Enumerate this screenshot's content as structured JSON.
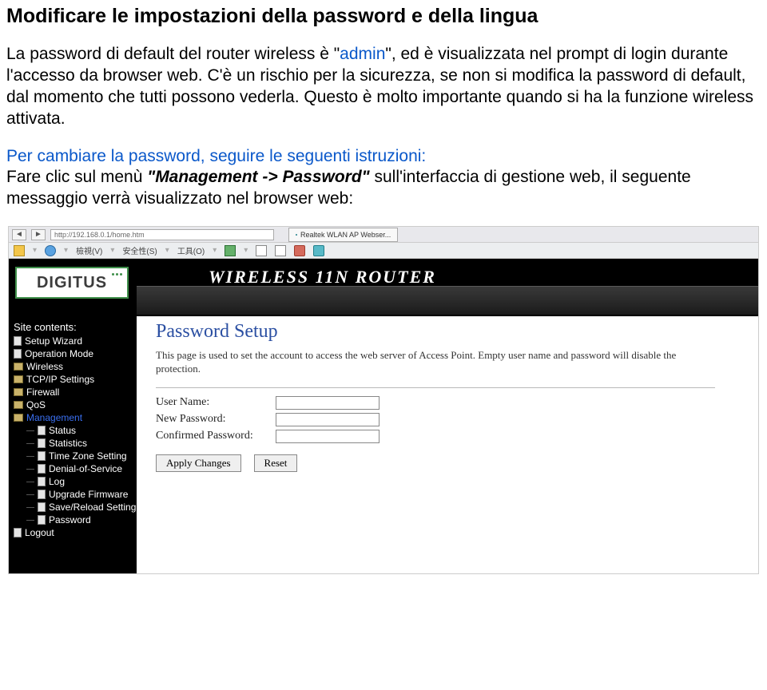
{
  "doc": {
    "title": "Modificare le impostazioni della password e della lingua",
    "para1_before": "La password di default del router wireless è \"",
    "para1_admin": "admin",
    "para1_after": "\", ed è visualizzata nel prompt di login durante l'accesso da browser web. C'è un rischio per la sicurezza, se non si modifica la password di default, dal momento che tutti possono vederla. Questo è molto importante quando si ha la funzione wireless attivata.",
    "para2_intro": "Per cambiare la password, seguire le seguenti istruzioni:",
    "para2_before": "Fare clic sul menù ",
    "para2_bold": "\"Management -> Password\"",
    "para2_after": " sull'interfaccia di gestione web, il seguente messaggio verrà visualizzato nel browser web:"
  },
  "browser": {
    "address": "http://192.168.0.1/home.htm",
    "tab": "Realtek WLAN AP Webser...",
    "menu_items": [
      "檢視(V)",
      "安全性(S)",
      "工具(O)"
    ]
  },
  "router": {
    "logo": "DIGITUS",
    "title": "WIRELESS 11N ROUTER"
  },
  "sidebar": {
    "header": "Site contents:",
    "items": [
      {
        "label": "Setup Wizard",
        "type": "page",
        "sub": false
      },
      {
        "label": "Operation Mode",
        "type": "page",
        "sub": false
      },
      {
        "label": "Wireless",
        "type": "folder",
        "sub": false
      },
      {
        "label": "TCP/IP Settings",
        "type": "folder",
        "sub": false
      },
      {
        "label": "Firewall",
        "type": "folder",
        "sub": false
      },
      {
        "label": "QoS",
        "type": "folder",
        "sub": false
      },
      {
        "label": "Management",
        "type": "folder",
        "sub": false,
        "selected": true
      },
      {
        "label": "Status",
        "type": "page",
        "sub": true
      },
      {
        "label": "Statistics",
        "type": "page",
        "sub": true
      },
      {
        "label": "Time Zone Setting",
        "type": "page",
        "sub": true
      },
      {
        "label": "Denial-of-Service",
        "type": "page",
        "sub": true
      },
      {
        "label": "Log",
        "type": "page",
        "sub": true
      },
      {
        "label": "Upgrade Firmware",
        "type": "page",
        "sub": true
      },
      {
        "label": "Save/Reload Setting",
        "type": "page",
        "sub": true
      },
      {
        "label": "Password",
        "type": "page",
        "sub": true
      },
      {
        "label": "Logout",
        "type": "page",
        "sub": false
      }
    ]
  },
  "content": {
    "heading": "Password Setup",
    "desc": "This page is used to set the account to access the web server of Access Point. Empty user name and password will disable the protection.",
    "user_label": "User Name:",
    "newpass_label": "New Password:",
    "confpass_label": "Confirmed Password:",
    "apply": "Apply Changes",
    "reset": "Reset"
  }
}
